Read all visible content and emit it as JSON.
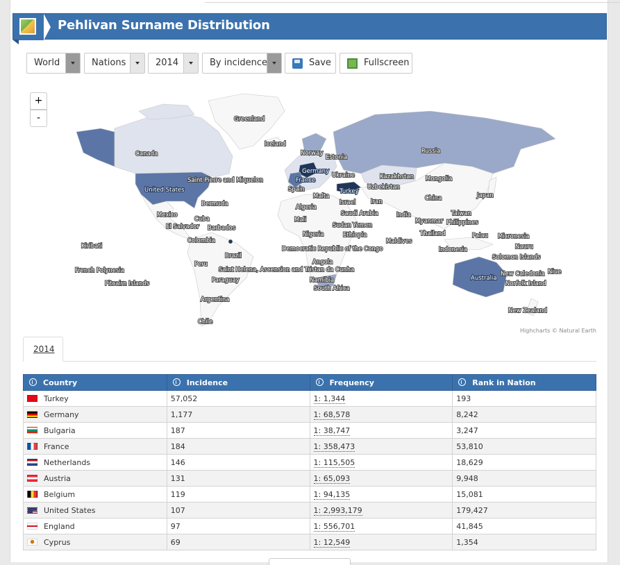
{
  "header": {
    "title": "Pehlivan Surname Distribution",
    "icon": "map-icon"
  },
  "toolbar": {
    "region": "World",
    "level": "Nations",
    "year": "2014",
    "mode": "By incidence",
    "save_label": "Save",
    "fullscreen_label": "Fullscreen"
  },
  "map": {
    "zoom_in": "+",
    "zoom_out": "-",
    "credits": "Highcharts © Natural Earth",
    "colors": {
      "none": "#f7f7f7",
      "low": "#dfe3ee",
      "medium": "#9aa9c9",
      "high": "#5b76a6",
      "max": "#1f3658"
    },
    "labels": [
      "Greenland",
      "Iceland",
      "Norway",
      "Estonia",
      "Canada",
      "Russia",
      "Germany",
      "Ukraine",
      "France",
      "Kazakhstan",
      "Mongolia",
      "Saint Pierre and Miquelon",
      "United States",
      "Spain",
      "Turkey",
      "Uzbekistan",
      "Japan",
      "China",
      "Bermuda",
      "Malta",
      "Israel",
      "Iran",
      "Algeria",
      "Taiwan",
      "Saudi Arabia",
      "India",
      "Mexico",
      "Cuba",
      "Mali",
      "Myanmar",
      "Philippines",
      "El Salvador",
      "Barbados",
      "Sudan",
      "Yemen",
      "Nigeria",
      "Ethiopia",
      "Thailand",
      "Palau",
      "Micronesia",
      "Colombia",
      "Maldives",
      "Kiribati",
      "Democratic Republic of the Congo",
      "Indonesia",
      "Nauru",
      "Solomon Islands",
      "Brazil",
      "Angola",
      "Peru",
      "French Polynesia",
      "Saint Helena, Ascension and Tristan da Cunha",
      "Niue",
      "New Caledonia",
      "Australia",
      "Paraguay",
      "Namibia",
      "Norfolk Island",
      "Pitcairn Islands",
      "South Africa",
      "Argentina",
      "New Zealand",
      "Chile"
    ]
  },
  "tabs": [
    {
      "label": "2014"
    }
  ],
  "table": {
    "headers": [
      "Country",
      "Incidence",
      "Frequency",
      "Rank in Nation"
    ],
    "rows": [
      {
        "country": "Turkey",
        "incidence": "57,052",
        "frequency": "1: 1,344",
        "rank": "193"
      },
      {
        "country": "Germany",
        "incidence": "1,177",
        "frequency": "1: 68,578",
        "rank": "8,242"
      },
      {
        "country": "Bulgaria",
        "incidence": "187",
        "frequency": "1: 38,747",
        "rank": "3,247"
      },
      {
        "country": "France",
        "incidence": "184",
        "frequency": "1: 358,473",
        "rank": "53,810"
      },
      {
        "country": "Netherlands",
        "incidence": "146",
        "frequency": "1: 115,505",
        "rank": "18,629"
      },
      {
        "country": "Austria",
        "incidence": "131",
        "frequency": "1: 65,093",
        "rank": "9,948"
      },
      {
        "country": "Belgium",
        "incidence": "119",
        "frequency": "1: 94,135",
        "rank": "15,081"
      },
      {
        "country": "United States",
        "incidence": "107",
        "frequency": "1: 2,993,179",
        "rank": "179,427"
      },
      {
        "country": "England",
        "incidence": "97",
        "frequency": "1: 556,701",
        "rank": "41,845"
      },
      {
        "country": "Cyprus",
        "incidence": "69",
        "frequency": "1: 12,549",
        "rank": "1,354"
      }
    ]
  }
}
